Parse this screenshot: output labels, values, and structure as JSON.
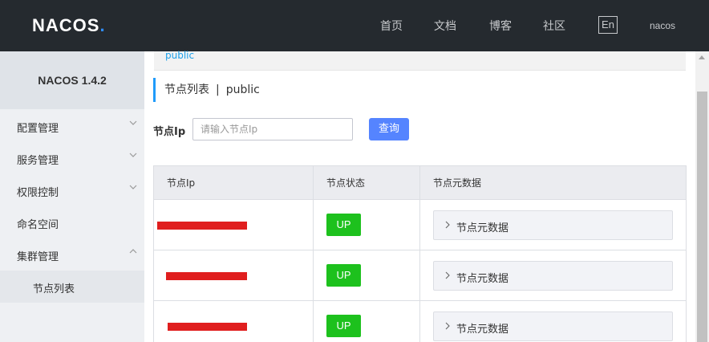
{
  "header": {
    "logo": {
      "part1": "NAC",
      "part2": "O",
      "part3": "S",
      "dot": "."
    },
    "nav": [
      "首页",
      "文档",
      "博客",
      "社区"
    ],
    "lang_button": "En",
    "user": "nacos"
  },
  "sidebar": {
    "title": "NACOS 1.4.2",
    "items": [
      {
        "label": "配置管理",
        "expanded": false
      },
      {
        "label": "服务管理",
        "expanded": false
      },
      {
        "label": "权限控制",
        "expanded": false
      },
      {
        "label": "命名空间"
      },
      {
        "label": "集群管理",
        "expanded": true
      }
    ],
    "sub_items": [
      {
        "label": "节点列表"
      }
    ]
  },
  "main": {
    "namespace_strip": "public",
    "section_title": "节点列表",
    "section_sep": "|",
    "section_namespace": "public",
    "filter": {
      "label": "节点Ip",
      "placeholder": "请输入节点Ip",
      "value": "",
      "button": "查询"
    },
    "table": {
      "columns": [
        "节点Ip",
        "节点状态",
        "节点元数据"
      ],
      "rows": [
        {
          "ip": "[redacted]",
          "status": "UP",
          "metadata": "节点元数据"
        },
        {
          "ip": "[redacted]",
          "status": "UP",
          "metadata": "节点元数据"
        },
        {
          "ip": "[redacted]",
          "status": "UP",
          "metadata": "节点元数据"
        }
      ]
    }
  },
  "colors": {
    "header_bg": "#252a2f",
    "primary": "#5584ff",
    "status_up": "#1dc11d",
    "redaction": "#e01e1e",
    "accent_link": "#1ea1ea"
  }
}
